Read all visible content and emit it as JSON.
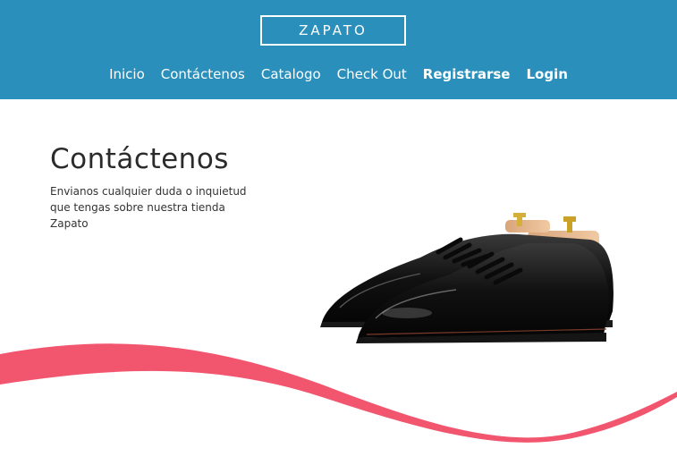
{
  "brand": {
    "name": "ZAPATO"
  },
  "nav": {
    "items": [
      {
        "label": "Inicio"
      },
      {
        "label": "Contáctenos"
      },
      {
        "label": "Catalogo"
      },
      {
        "label": "Check Out"
      },
      {
        "label": "Registrarse"
      },
      {
        "label": "Login"
      }
    ]
  },
  "hero": {
    "title": "Contáctenos",
    "description": "Envianos cualquier duda o inquietud que tengas sobre nuestra tienda Zapato"
  },
  "colors": {
    "header_bg": "#2a8fba",
    "accent_wave": "#f2556e",
    "text_dark": "#2b2b2b"
  },
  "images": {
    "hero_image": "black-oxford-shoes-with-shoe-trees"
  }
}
